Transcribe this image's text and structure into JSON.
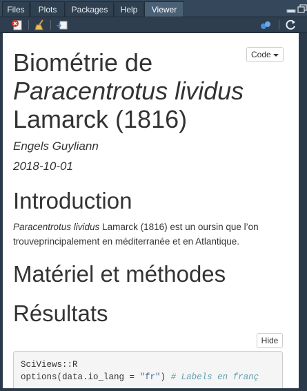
{
  "tabs": [
    {
      "label": "Files"
    },
    {
      "label": "Plots"
    },
    {
      "label": "Packages"
    },
    {
      "label": "Help"
    },
    {
      "label": "Viewer",
      "active": true
    }
  ],
  "toolbar": {
    "icons": [
      "clear-viewer-icon",
      "broom-icon",
      "export-icon",
      "publish-icon",
      "refresh-icon"
    ]
  },
  "document": {
    "code_button_label": "Code",
    "title_line1": "Biométrie de",
    "title_line2": "Paracentrotus lividus",
    "title_line3": "Lamarck (1816)",
    "author": "Engels Guyliann",
    "date": "2018-10-01",
    "sections": [
      {
        "heading": "Introduction"
      },
      {
        "heading": "Matériel et méthodes"
      },
      {
        "heading": "Résultats"
      }
    ],
    "intro_species": "Paracentrotus lividus",
    "intro_text": " Lamarck (1816) est un oursin que l’on trouveprincipalement en méditerranée et en Atlantique.",
    "hide_button_label": "Hide",
    "code_line1": "SciViews::R",
    "code_line2_prefix": "options(data.io_lang = ",
    "code_line2_string": "\"fr\"",
    "code_line2_suffix": ") ",
    "code_line2_comment": "# Labels en franç"
  },
  "colors": {
    "pane_bg": "#2b3a4a",
    "active_tab": "#4a6075",
    "content_bg": "#ffffff",
    "code_bg": "#f5f5f5"
  }
}
